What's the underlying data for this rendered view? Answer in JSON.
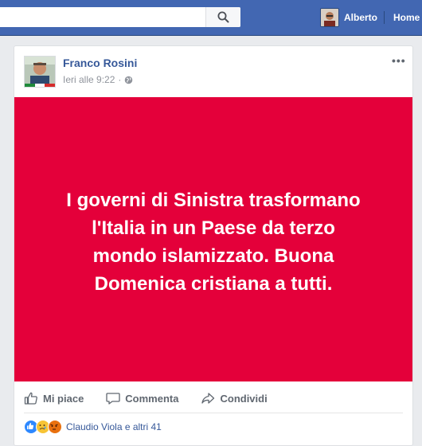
{
  "topbar": {
    "search_placeholder": "",
    "profile_name": "Alberto",
    "home_label": "Home"
  },
  "post": {
    "author": "Franco Rosini",
    "timestamp": "Ieri alle 9:22",
    "visibility_icon": "globe-icon",
    "message": "I governi di Sinistra trasformano l'Italia in un Paese da terzo mondo islamizzato. Buona Domenica cristiana a tutti.",
    "background_color": "#e4003a",
    "actions": {
      "like": "Mi piace",
      "comment": "Commenta",
      "share": "Condividi"
    },
    "reactions_summary": "Claudio Viola e altri 41",
    "reaction_icons": [
      "like-icon",
      "sad-icon",
      "angry-icon"
    ]
  },
  "colors": {
    "brand": "#4267b2",
    "link": "#365899"
  }
}
